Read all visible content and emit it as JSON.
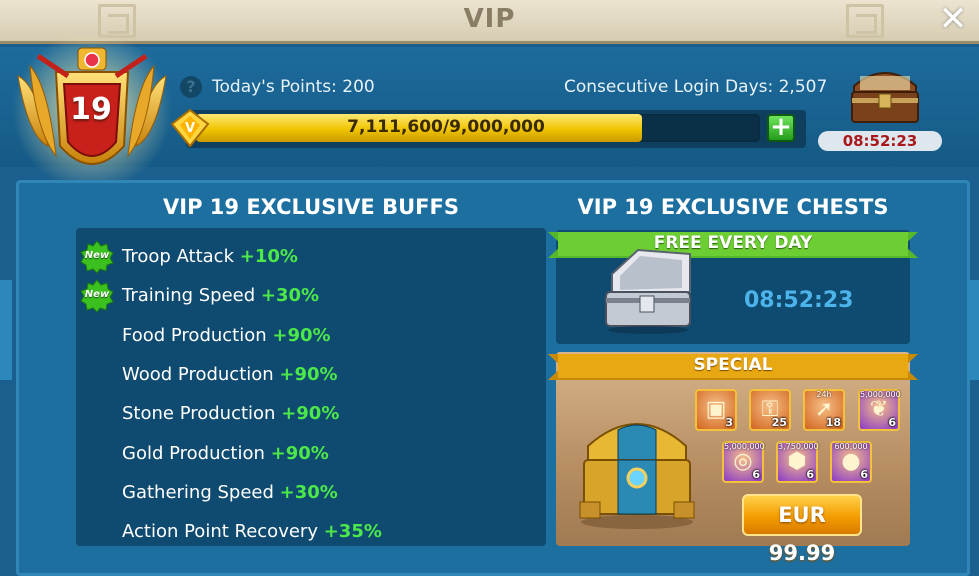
{
  "window": {
    "title": "VIP"
  },
  "header": {
    "vip_level": "19",
    "todays_points": "Today's Points: 200",
    "login_days": "Consecutive Login Days: 2,507",
    "progress_text": "7,111,600/9,000,000",
    "progress_fraction": 0.79,
    "chest_timer": "08:52:23"
  },
  "buffs": {
    "title": "VIP 19 EXCLUSIVE BUFFS",
    "new_badge": "New",
    "items": [
      {
        "name": "Troop Attack",
        "value": "+10%",
        "new": true
      },
      {
        "name": "Training Speed",
        "value": "+30%",
        "new": true
      },
      {
        "name": "Food Production",
        "value": "+90%",
        "new": false
      },
      {
        "name": "Wood Production",
        "value": "+90%",
        "new": false
      },
      {
        "name": "Stone Production",
        "value": "+90%",
        "new": false
      },
      {
        "name": "Gold Production",
        "value": "+90%",
        "new": false
      },
      {
        "name": "Gathering Speed",
        "value": "+30%",
        "new": false
      },
      {
        "name": "Action Point Recovery",
        "value": "+35%",
        "new": false
      }
    ]
  },
  "chests": {
    "title": "VIP 19 EXCLUSIVE CHESTS",
    "free_label": "FREE EVERY DAY",
    "free_timer": "08:52:23",
    "special_label": "SPECIAL",
    "items": [
      {
        "icon": "chest-icon",
        "qty": "3",
        "top": ""
      },
      {
        "icon": "key-chest-icon",
        "qty": "25",
        "top": ""
      },
      {
        "icon": "speedup-icon",
        "qty": "18",
        "top": "24h"
      },
      {
        "icon": "food-icon",
        "qty": "6",
        "top": "5,000,000"
      },
      {
        "icon": "wood-icon",
        "qty": "6",
        "top": "5,000,000"
      },
      {
        "icon": "stone-icon",
        "qty": "6",
        "top": "3,750,000"
      },
      {
        "icon": "gold-icon",
        "qty": "6",
        "top": "600,000"
      }
    ],
    "price": "EUR 99.99"
  }
}
